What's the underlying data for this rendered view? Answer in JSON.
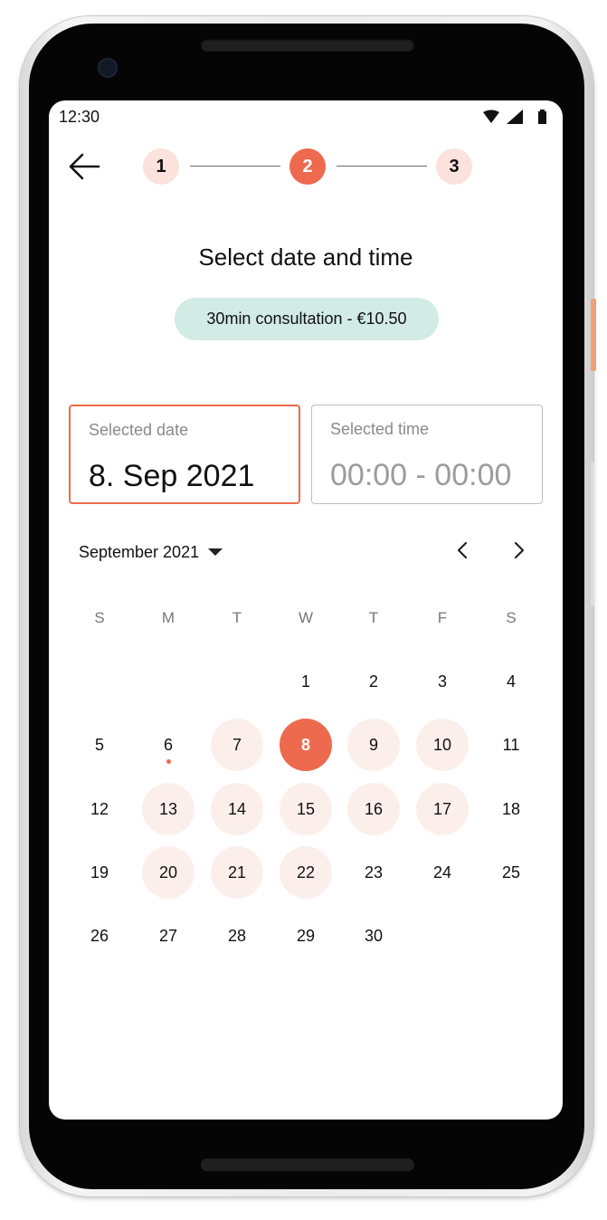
{
  "status_bar": {
    "time": "12:30",
    "icons": [
      "wifi-icon",
      "signal-icon",
      "battery-icon"
    ]
  },
  "stepper": {
    "steps": [
      "1",
      "2",
      "3"
    ],
    "active_index": 1
  },
  "title": "Select date and time",
  "consultation_chip": "30min consultation - €10.50",
  "selected_date": {
    "label": "Selected date",
    "value": "8. Sep 2021"
  },
  "selected_time": {
    "label": "Selected time",
    "value": "00:00 - 00:00"
  },
  "calendar": {
    "month_label": "September 2021",
    "weekdays": [
      "S",
      "M",
      "T",
      "W",
      "T",
      "F",
      "S"
    ],
    "weeks": [
      [
        "",
        "",
        "",
        "1",
        "2",
        "3",
        "4"
      ],
      [
        "5",
        "6",
        "7",
        "8",
        "9",
        "10",
        "11"
      ],
      [
        "12",
        "13",
        "14",
        "15",
        "16",
        "17",
        "18"
      ],
      [
        "19",
        "20",
        "21",
        "22",
        "23",
        "24",
        "25"
      ],
      [
        "26",
        "27",
        "28",
        "29",
        "30",
        "",
        ""
      ]
    ],
    "available_days": [
      "7",
      "9",
      "10",
      "13",
      "14",
      "15",
      "16",
      "17",
      "20",
      "21",
      "22"
    ],
    "selected_day": "8",
    "today": "6"
  },
  "colors": {
    "accent": "#ee6a4e",
    "accent_light": "#fcefeb",
    "chip_bg": "#d2ebe5"
  }
}
